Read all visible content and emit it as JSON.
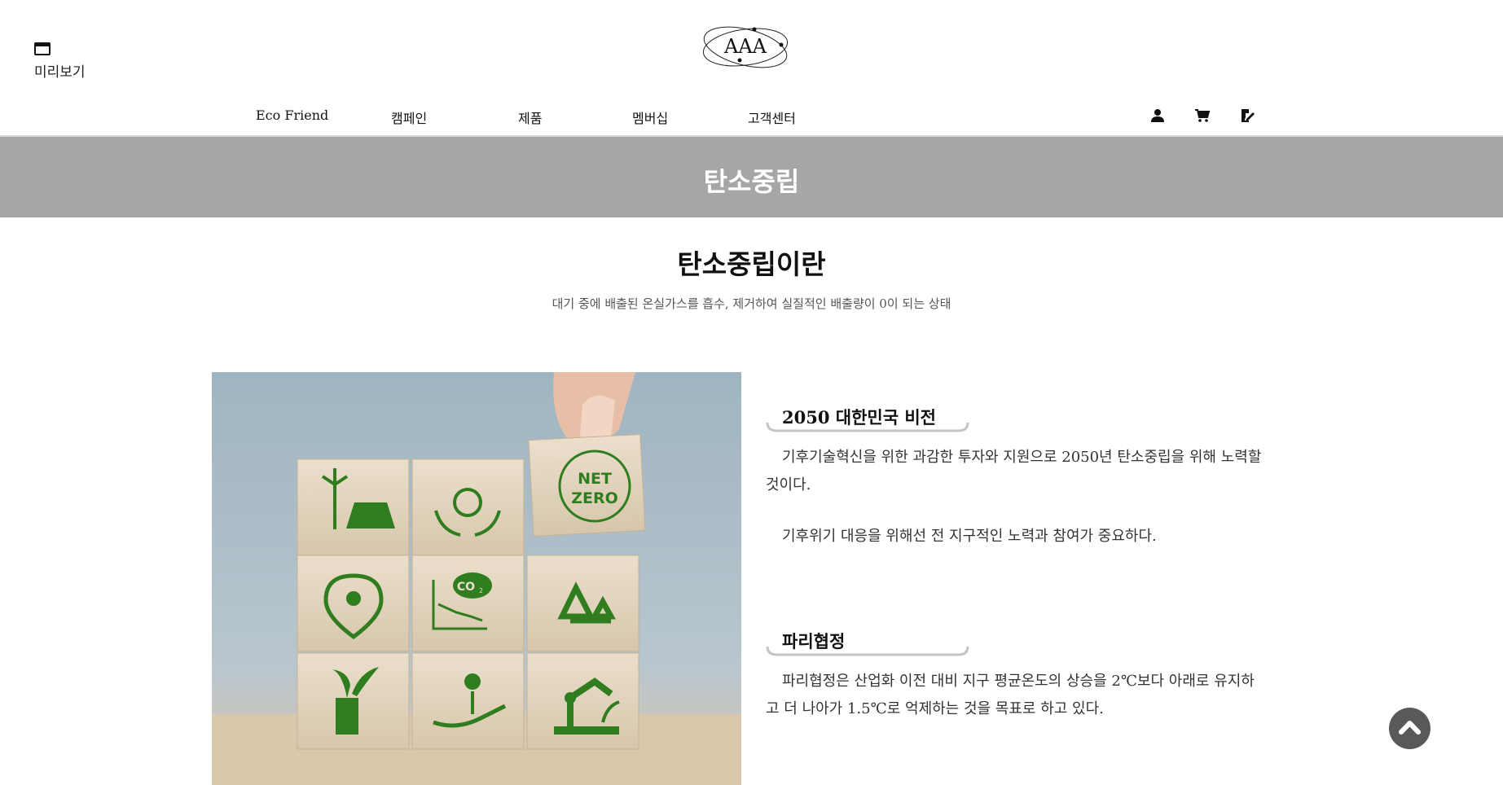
{
  "header": {
    "preview_label": "미리보기",
    "logo_text": "AAA"
  },
  "nav": {
    "items": [
      {
        "label": "Eco Friend"
      },
      {
        "label": "캠페인"
      },
      {
        "label": "제품"
      },
      {
        "label": "멤버십"
      },
      {
        "label": "고객센터"
      }
    ],
    "icons": [
      "user-icon",
      "cart-icon",
      "edit-icon"
    ]
  },
  "banner": {
    "title": "탄소중립"
  },
  "intro": {
    "title": "탄소중립이란",
    "description": "대기 중에 배출된 온실가스를 흡수, 제거하여 실질적인 배출량이 0이 되는 상태"
  },
  "photo": {
    "badge_line1": "NET",
    "badge_line2": "ZERO",
    "co2_text": "CO",
    "co2_sub": "2"
  },
  "content": {
    "vision": {
      "heading": "2050 대한민국 비전",
      "para1": "기후기술혁신을 위한 과감한 투자와 지원으로 2050년 탄소중립을 위해 노력할 것이다.",
      "para2": "기후위기 대응을 위해선 전 지구적인 노력과 참여가 중요하다."
    },
    "paris": {
      "heading": "파리협정",
      "para1": "파리협정은 산업화 이전 대비 지구 평균온도의 상승을 2℃보다 아래로 유지하고 더 나아가 1.5℃로 억제하는 것을 목표로 하고 있다."
    }
  },
  "colors": {
    "banner_bg": "#a6a6a6",
    "icon_green": "#2f7d1f",
    "top_button_bg": "#595959"
  }
}
